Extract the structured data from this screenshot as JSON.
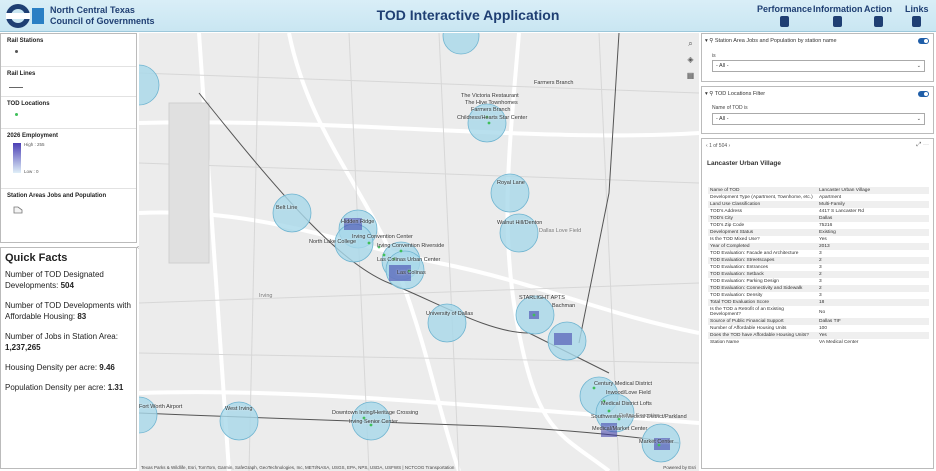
{
  "header": {
    "org_line1": "North Central Texas",
    "org_line2": "Council of Governments",
    "title": "TOD Interactive Application",
    "nav": [
      "Performance",
      "Information",
      "Action",
      "Links"
    ]
  },
  "legend": {
    "rail_stations": "Rail Stations",
    "rail_lines": "Rail Lines",
    "tod_locations": "TOD Locations",
    "employment": "2026 Employment",
    "high": "High : 255",
    "low": "Low : 0",
    "station_areas": "Station Areas Jobs and Population"
  },
  "facts": {
    "title": "Quick Facts",
    "designated_label": "Number of TOD Designated Developments:",
    "designated_value": "504",
    "affordable_label": "Number of TOD Developments with Affordable Housing:",
    "affordable_value": "83",
    "jobs_label": "Number of Jobs in Station Area:",
    "jobs_value": "1,237,265",
    "housing_label": "Housing Density per acre:",
    "housing_value": "9.46",
    "pop_label": "Population Density per acre:",
    "pop_value": "1.31"
  },
  "map": {
    "labels": [
      "The Victoria Restaurant",
      "The Hive Townhomes",
      "Farmers Branch",
      "Childress/Hearts Star Center",
      "Farmers Branch",
      "Royal Lane",
      "Walnut Hill/Denton",
      "Belt Line",
      "Hidden Ridge",
      "Irving Convention Center",
      "North Lake College",
      "Irving Convention Riverside",
      "Las Colinas Urban Center",
      "Las Colinas",
      "University of Dallas",
      "STARLIGHT APTS",
      "Bachman",
      "Century Medical District",
      "Inwood/Love Field",
      "Medical District Lofts",
      "Southwestern Medical District/Parkland",
      "Medical/Market Center",
      "Market Center",
      "West Irving",
      "Downtown Irving/Heritage Crossing",
      "Irving Senior Center",
      "Fort Worth Airport",
      "Dallas Love Field",
      "Dallas Executive",
      "Irving"
    ],
    "attribution": "Texas Parks & Wildlife, Esri, TomTom, Garmin, SafeGraph, GeoTechnologies, Inc, METI/NASA, USGS, EPA, NPS, USDA, USFWS | NCTCOG Transportation",
    "esri": "Powered by Esri"
  },
  "filter1": {
    "title": "Station Area Jobs and Population by station name",
    "label": "is",
    "value": "- All -"
  },
  "filter2": {
    "title": "TOD Locations Filter",
    "label": "Name of TOD is",
    "value": "- All -"
  },
  "detail": {
    "pager": "1 of 504",
    "title": "Lancaster Urban Village",
    "rows": [
      [
        "Name of TOD",
        "Lancaster Urban Village"
      ],
      [
        "Development Type (Apartment, Townhome, etc.)",
        "Apartment"
      ],
      [
        "Land Use Classification",
        "Multi-Family"
      ],
      [
        "TOD's Address",
        "4417 S Lancaster Rd"
      ],
      [
        "TOD's City",
        "Dallas"
      ],
      [
        "TOD's Zip Code",
        "75216"
      ],
      [
        "Development Status",
        "Existing"
      ],
      [
        "Is the TOD Mixed Use?",
        "Yes"
      ],
      [
        "Year of Completed",
        "2013"
      ],
      [
        "TOD Evaluation: Facade and Architecture",
        "3"
      ],
      [
        "TOD Evaluation: Streetscapes",
        "2"
      ],
      [
        "TOD Evaluation: Entrances",
        "3"
      ],
      [
        "TOD Evaluation: Setback",
        "2"
      ],
      [
        "TOD Evaluation: Parking Design",
        "3"
      ],
      [
        "TOD Evaluation: Connectivity and Sidewalk",
        "2"
      ],
      [
        "TOD Evaluation: Density",
        "3"
      ],
      [
        "Total TOD Evaluation Score",
        "18"
      ],
      [
        "Is the TOD a Retrofit of an Existing Development?",
        "No"
      ],
      [
        "Source of Public Financial Support",
        "Dallas TIF"
      ],
      [
        "Number of Affordable Housing Units",
        "100"
      ],
      [
        "Does the TOD have Affordable Housing Units?",
        "Yes"
      ],
      [
        "Station Name",
        "VA Medical Center"
      ]
    ]
  },
  "colors": {
    "header_text": "#1f3f73",
    "station_circle": "#a8d8ea",
    "density_high": "#3b3ba8",
    "tod_point": "#3fbf5a"
  }
}
